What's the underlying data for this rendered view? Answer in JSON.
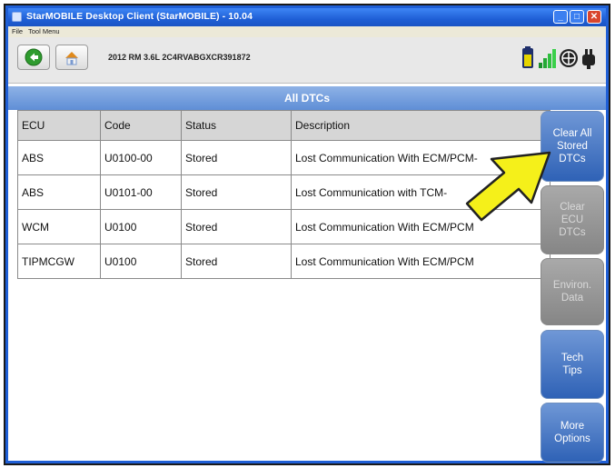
{
  "window": {
    "title": "StarMOBILE Desktop Client (StarMOBILE) - 10.04",
    "controls": {
      "minimize": "_",
      "maximize": "□",
      "close": "✕"
    }
  },
  "menubar": {
    "items": [
      "File",
      "Tool Menu"
    ]
  },
  "toolbar": {
    "back_icon": "back-arrow-icon",
    "home_icon": "home-icon",
    "vehicle_info": "2012 RM 3.6L 2C4RVABGXCR391872",
    "status_icons": [
      "battery-icon",
      "signal-icon",
      "network-icon",
      "connector-icon"
    ]
  },
  "header": {
    "title": "All DTCs"
  },
  "table": {
    "columns": [
      "ECU",
      "Code",
      "Status",
      "Description"
    ],
    "rows": [
      [
        "ABS",
        "U0100-00",
        "Stored",
        "Lost Communication With ECM/PCM-"
      ],
      [
        "ABS",
        "U0101-00",
        "Stored",
        "Lost Communication with TCM-"
      ],
      [
        "WCM",
        "U0100",
        "Stored",
        "Lost Communication With ECM/PCM"
      ],
      [
        "TIPMCGW",
        "U0100",
        "Stored",
        "Lost Communication With ECM/PCM"
      ]
    ]
  },
  "side_buttons": [
    {
      "label": "Clear All\nStored\nDTCs",
      "state": "active"
    },
    {
      "label": "Clear\nECU\nDTCs",
      "state": "disabled"
    },
    {
      "label": "Environ.\nData",
      "state": "disabled"
    },
    {
      "label": "Tech\nTips",
      "state": "active"
    },
    {
      "label": "More\nOptions",
      "state": "active"
    }
  ],
  "annotation": {
    "arrow_color": "#f5f01a",
    "outline_color": "#222222"
  },
  "colors": {
    "title_bar": "#1f5fd6",
    "header_bar": "#6f97dc",
    "side_button": "#3f6fc0",
    "close_button": "#d9452c"
  }
}
